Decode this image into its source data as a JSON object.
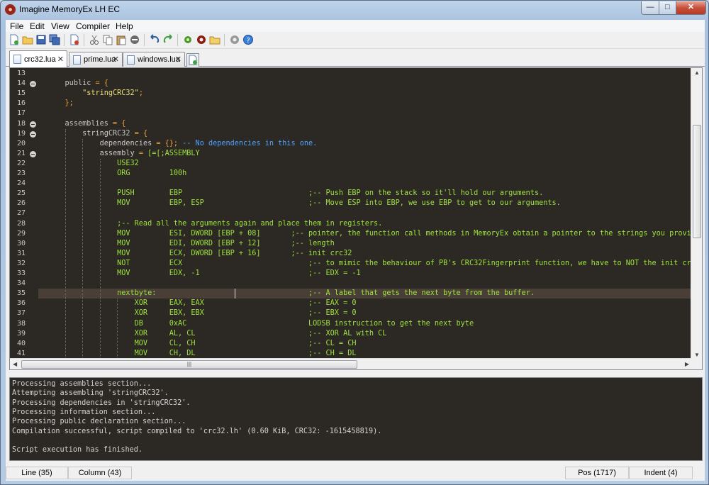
{
  "window": {
    "title": "Imagine MemoryEx LH EC",
    "minimize": "—",
    "maximize": "□",
    "close": "✕"
  },
  "menu": [
    "File",
    "Edit",
    "View",
    "Compiler",
    "Help"
  ],
  "toolbar": {
    "icons": [
      "new-file-icon",
      "open-file-icon",
      "save-icon",
      "save-all-icon",
      "close-file-icon",
      "cut-icon",
      "copy-icon",
      "paste-icon",
      "delete-icon",
      "undo-icon",
      "redo-icon",
      "compile-icon",
      "settings-gear-icon",
      "folder-icon",
      "preferences-icon",
      "help-icon"
    ]
  },
  "tabs": [
    {
      "label": "crc32.lua",
      "close": "✕",
      "active": true
    },
    {
      "label": "prime.lua",
      "close": "✕",
      "active": false
    },
    {
      "label": "windows.lua",
      "close": "✕",
      "active": false
    }
  ],
  "colors": {
    "keyword": "#c9c9c9",
    "text": "#d4d4d4",
    "string": "#e9e07a",
    "operator": "#e8a33a",
    "comment": "#4da3ff",
    "asm": "#9ee23f",
    "lbl": "#d6c26b"
  },
  "editor": {
    "lines": [
      {
        "n": "13",
        "fold": false,
        "depth": 0,
        "segs": []
      },
      {
        "n": "14",
        "fold": true,
        "depth": 0,
        "segs": [
          [
            "    ",
            "text"
          ],
          [
            "public",
            "keyword"
          ],
          [
            " = {",
            "operator"
          ]
        ]
      },
      {
        "n": "15",
        "fold": false,
        "depth": 1,
        "segs": [
          [
            "        ",
            "text"
          ],
          [
            "\"stringCRC32\"",
            "string"
          ],
          [
            ";",
            "operator"
          ]
        ]
      },
      {
        "n": "16",
        "fold": false,
        "depth": 1,
        "segs": [
          [
            "    ",
            "text"
          ],
          [
            "};",
            "operator"
          ]
        ]
      },
      {
        "n": "17",
        "fold": false,
        "depth": 0,
        "segs": []
      },
      {
        "n": "18",
        "fold": true,
        "depth": 0,
        "segs": [
          [
            "    ",
            "text"
          ],
          [
            "assemblies",
            "keyword"
          ],
          [
            " = {",
            "operator"
          ]
        ]
      },
      {
        "n": "19",
        "fold": true,
        "depth": 1,
        "segs": [
          [
            "        ",
            "text"
          ],
          [
            "stringCRC32",
            "keyword"
          ],
          [
            " = {",
            "operator"
          ]
        ]
      },
      {
        "n": "20",
        "fold": false,
        "depth": 2,
        "segs": [
          [
            "            ",
            "text"
          ],
          [
            "dependencies",
            "keyword"
          ],
          [
            " = {}; ",
            "operator"
          ],
          [
            "-- No dependencies in this one.",
            "comment"
          ]
        ]
      },
      {
        "n": "21",
        "fold": true,
        "depth": 2,
        "segs": [
          [
            "            ",
            "text"
          ],
          [
            "assembly",
            "keyword"
          ],
          [
            " = ",
            "operator"
          ],
          [
            "[=[;ASSEMBLY",
            "asm"
          ]
        ]
      },
      {
        "n": "22",
        "fold": false,
        "depth": 3,
        "segs": [
          [
            "                USE32",
            "asm"
          ]
        ]
      },
      {
        "n": "23",
        "fold": false,
        "depth": 3,
        "segs": [
          [
            "                ORG         100h",
            "asm"
          ]
        ]
      },
      {
        "n": "24",
        "fold": false,
        "depth": 3,
        "segs": []
      },
      {
        "n": "25",
        "fold": false,
        "depth": 3,
        "segs": [
          [
            "                PUSH        EBP                             ;-- Push EBP on the stack so it'll hold our arguments.",
            "asm"
          ]
        ]
      },
      {
        "n": "26",
        "fold": false,
        "depth": 3,
        "segs": [
          [
            "                MOV         EBP, ESP                        ;-- Move ESP into EBP, we use EBP to get to our arguments.",
            "asm"
          ]
        ]
      },
      {
        "n": "27",
        "fold": false,
        "depth": 3,
        "segs": []
      },
      {
        "n": "28",
        "fold": false,
        "depth": 3,
        "segs": [
          [
            "                ;-- Read all the arguments again and place them in registers.",
            "asm"
          ]
        ]
      },
      {
        "n": "29",
        "fold": false,
        "depth": 3,
        "segs": [
          [
            "                MOV         ESI, DWORD [EBP + 08]       ;-- pointer, the function call methods in MemoryEx obtain a pointer to the strings you provi",
            "asm"
          ]
        ]
      },
      {
        "n": "30",
        "fold": false,
        "depth": 3,
        "segs": [
          [
            "                MOV         EDI, DWORD [EBP + 12]       ;-- length",
            "asm"
          ]
        ]
      },
      {
        "n": "31",
        "fold": false,
        "depth": 3,
        "segs": [
          [
            "                MOV         ECX, DWORD [EBP + 16]       ;-- init crc32",
            "asm"
          ]
        ]
      },
      {
        "n": "32",
        "fold": false,
        "depth": 3,
        "segs": [
          [
            "                NOT         ECX                             ;-- to mimic the behaviour of PB's CRC32Fingerprint function, we have to NOT the init crc. U",
            "asm"
          ]
        ]
      },
      {
        "n": "33",
        "fold": false,
        "depth": 3,
        "segs": [
          [
            "                MOV         EDX, -1                         ;-- EDX = -1",
            "asm"
          ]
        ]
      },
      {
        "n": "34",
        "fold": false,
        "depth": 3,
        "segs": []
      },
      {
        "n": "35",
        "fold": false,
        "depth": 3,
        "cur": true,
        "segs": [
          [
            "                nextbyte:                                   ;-- A label that gets the next byte from the buffer.",
            "asm"
          ]
        ]
      },
      {
        "n": "36",
        "fold": false,
        "depth": 4,
        "segs": [
          [
            "                    XOR     EAX, EAX                        ;-- EAX = 0",
            "asm"
          ]
        ]
      },
      {
        "n": "37",
        "fold": false,
        "depth": 4,
        "segs": [
          [
            "                    XOR     EBX, EBX                        ;-- EBX = 0",
            "asm"
          ]
        ]
      },
      {
        "n": "38",
        "fold": false,
        "depth": 4,
        "segs": [
          [
            "                    DB      0xAC                            LODSB instruction to get the next byte",
            "asm"
          ]
        ]
      },
      {
        "n": "39",
        "fold": false,
        "depth": 4,
        "segs": [
          [
            "                    XOR     AL, CL                          ;-- XOR AL with CL",
            "asm"
          ]
        ]
      },
      {
        "n": "40",
        "fold": false,
        "depth": 4,
        "segs": [
          [
            "                    MOV     CL, CH                          ;-- CL = CH",
            "asm"
          ]
        ]
      },
      {
        "n": "41",
        "fold": false,
        "depth": 4,
        "segs": [
          [
            "                    MOV     CH, DL                          ;-- CH = DL",
            "asm"
          ]
        ]
      }
    ],
    "hscroll_grip": "|||",
    "arrow_left": "◀",
    "arrow_right": "▶",
    "arrow_up": "▲",
    "arrow_down": "▼"
  },
  "output": {
    "lines": [
      "Processing assemblies section...",
      "Attempting assembling 'stringCRC32'.",
      "Processing dependencies in 'stringCRC32'.",
      "Processing information section...",
      "Processing public declaration section...",
      "Compilation successful, script compiled to 'crc32.lh' (0.60 KiB, CRC32: -1615458819).",
      "",
      "Script execution has finished."
    ]
  },
  "status": {
    "line": "Line (35)",
    "column": "Column (43)",
    "pos": "Pos (1717)",
    "indent": "Indent (4)"
  }
}
